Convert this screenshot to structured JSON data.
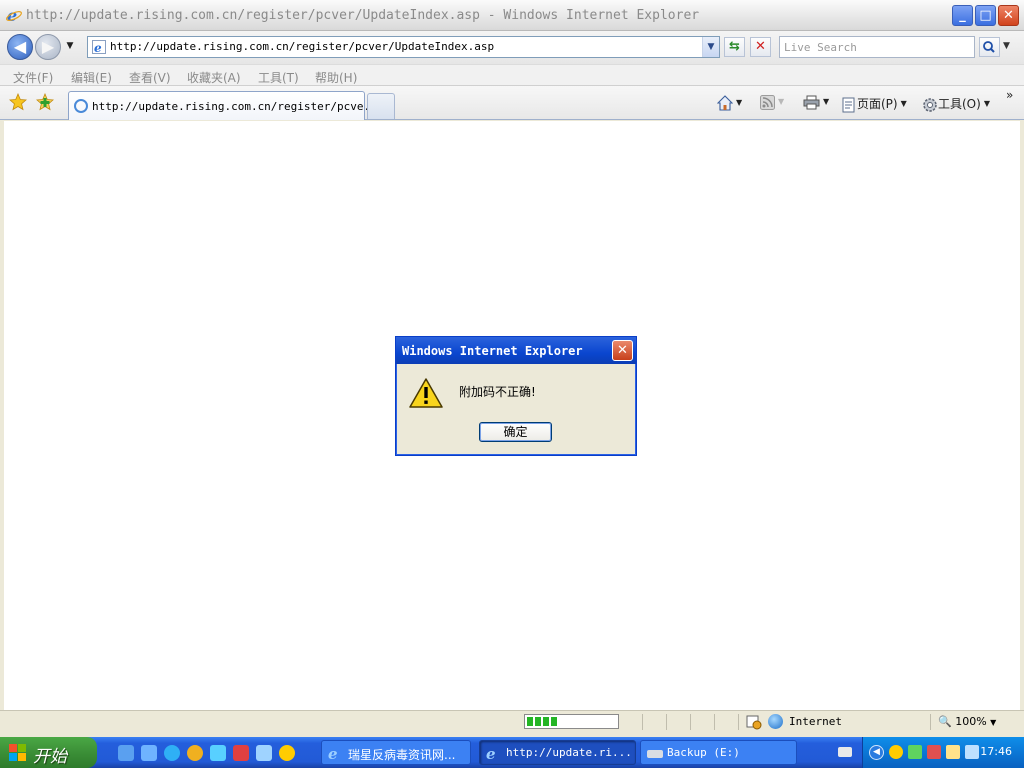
{
  "window": {
    "title": "http://update.rising.com.cn/register/pcver/UpdateIndex.asp - Windows Internet Explorer",
    "controls": {
      "minimize": "_",
      "maximize": "□",
      "close": "✕"
    }
  },
  "address_bar": {
    "url": "http://update.rising.com.cn/register/pcver/UpdateIndex.asp",
    "search_placeholder": "Live Search"
  },
  "menu": {
    "items": [
      "文件(F)",
      "编辑(E)",
      "查看(V)",
      "收藏夹(A)",
      "工具(T)",
      "帮助(H)"
    ]
  },
  "tabs": {
    "active_label": "http://update.rising.com.cn/register/pcve..."
  },
  "command_bar": {
    "page": "页面(P)",
    "tools": "工具(O)",
    "more": "»"
  },
  "dialog": {
    "title": "Windows Internet Explorer",
    "message": "附加码不正确!",
    "ok": "确定"
  },
  "status_bar": {
    "progress_percent": 40,
    "zone": "Internet",
    "zoom": "100%"
  },
  "taskbar": {
    "start": "开始",
    "tasks": [
      {
        "label": "瑞星反病毒资讯网..."
      },
      {
        "label": "http://update.ri..."
      },
      {
        "label": "Backup (E:)"
      }
    ],
    "clock": "17:46"
  },
  "colors": {
    "content_bg": "#ffffff",
    "dialog_title": "#0a46cf",
    "taskbar": "#245edc",
    "start_button": "#3b8f37"
  }
}
